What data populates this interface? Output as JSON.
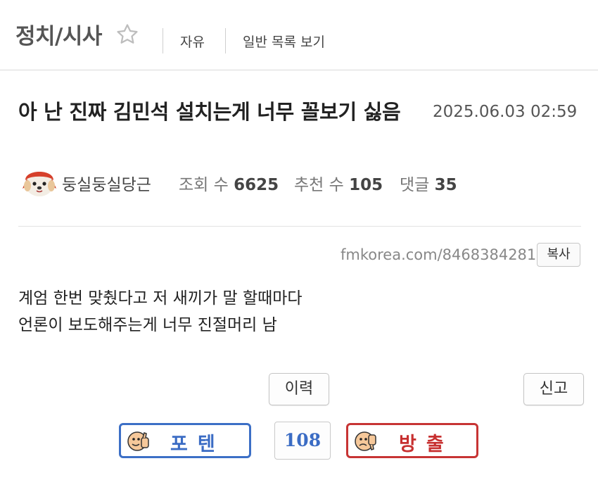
{
  "header": {
    "board_title": "정치/시사",
    "star_icon": "star-outline-icon",
    "nav_free": "자유",
    "nav_list": "일반 목록 보기"
  },
  "post": {
    "title": "아 난 진짜 김민석 설치는게 너무 꼴보기 싫음",
    "date": "2025.06.03 02:59",
    "author": "둥실둥실당근",
    "views_label": "조회 수",
    "views": "6625",
    "recommend_label": "추천 수",
    "recommend": "105",
    "comments_label": "댓글",
    "comments": "35",
    "url": "fmkorea.com/8468384281",
    "copy_label": "복사",
    "body_lines": [
      "계엄 한번 맞췄다고 저 새끼가 말 할때마다",
      "언론이 보도해주는게 너무 진절머리 남"
    ]
  },
  "actions": {
    "history_label": "이력",
    "report_label": "신고",
    "upvote_label": "포텐",
    "downvote_label": "방출",
    "vote_count": "108"
  },
  "colors": {
    "upvote": "#3c6fc6",
    "downvote": "#c73434"
  }
}
